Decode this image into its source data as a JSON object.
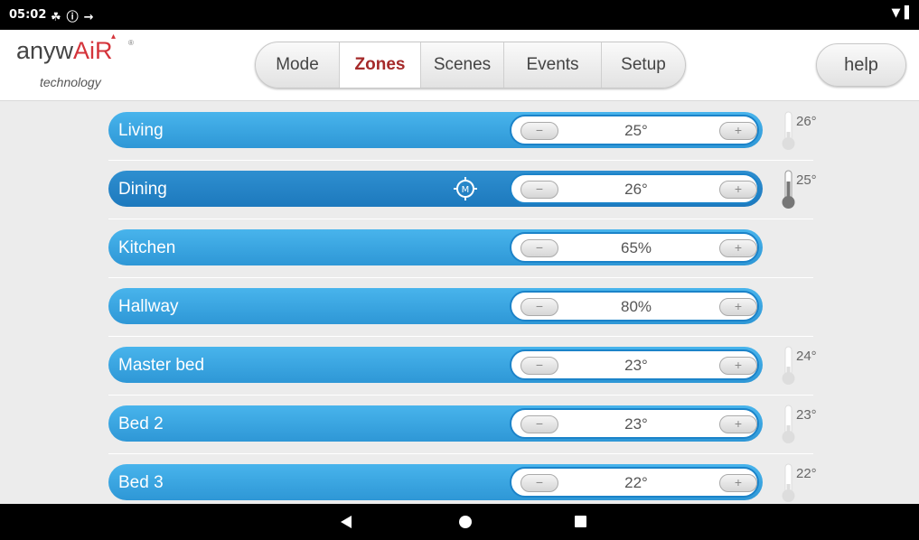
{
  "status": {
    "time": "05:02",
    "left_icons": [
      "notification-icon",
      "info-icon",
      "usb-icon"
    ],
    "right_icons": [
      "wifi-icon",
      "battery-icon"
    ]
  },
  "logo": {
    "brand_prefix": "anyw",
    "brand_air": "AiR",
    "reg": "®",
    "tagline": "technology"
  },
  "tabs": [
    {
      "label": "Mode",
      "active": false
    },
    {
      "label": "Zones",
      "active": true
    },
    {
      "label": "Scenes",
      "active": false
    },
    {
      "label": "Events",
      "active": false
    },
    {
      "label": "Setup",
      "active": false
    }
  ],
  "help_label": "help",
  "zones": [
    {
      "name": "Living",
      "setpoint": "25°",
      "actual": "26°",
      "has_thermo": true,
      "thermo_level": 0.3,
      "active": false,
      "mode_icon": false
    },
    {
      "name": "Dining",
      "setpoint": "26°",
      "actual": "25°",
      "has_thermo": true,
      "thermo_level": 0.6,
      "active": true,
      "mode_icon": true,
      "mode_icon_label": "M"
    },
    {
      "name": "Kitchen",
      "setpoint": "65%",
      "actual": "",
      "has_thermo": false,
      "active": false,
      "mode_icon": false
    },
    {
      "name": "Hallway",
      "setpoint": "80%",
      "actual": "",
      "has_thermo": false,
      "active": false,
      "mode_icon": false
    },
    {
      "name": "Master bed",
      "setpoint": "23°",
      "actual": "24°",
      "has_thermo": true,
      "thermo_level": 0.3,
      "active": false,
      "mode_icon": false
    },
    {
      "name": "Bed 2",
      "setpoint": "23°",
      "actual": "23°",
      "has_thermo": true,
      "thermo_level": 0.3,
      "active": false,
      "mode_icon": false
    },
    {
      "name": "Bed 3",
      "setpoint": "22°",
      "actual": "22°",
      "has_thermo": true,
      "thermo_level": 0.3,
      "active": false,
      "mode_icon": false
    }
  ],
  "buttons": {
    "minus": "−",
    "plus": "+"
  },
  "colors": {
    "brand_red": "#d4333a",
    "active_tab": "#a52a2a",
    "zone_blue": "#2e97d6",
    "zone_blue_active": "#1d79bd"
  },
  "nav": [
    "back-icon",
    "home-icon",
    "recents-icon"
  ]
}
